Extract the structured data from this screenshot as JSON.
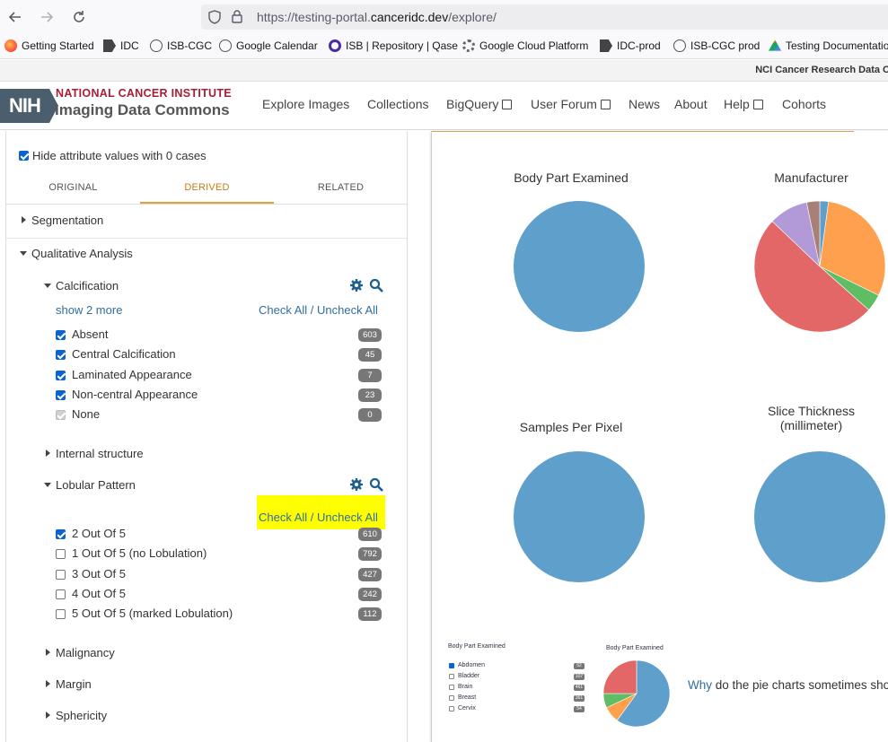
{
  "browser": {
    "url_prefix": "https://testing-portal.",
    "url_domain": "canceridc.dev",
    "url_path": "/explore/",
    "bookmarks": [
      "Getting Started",
      "IDC",
      "ISB-CGC",
      "Google Calendar",
      "ISB | Repository | Qase",
      "Google Cloud Platform",
      "IDC-prod",
      "ISB-CGC prod",
      "Testing Documentation"
    ]
  },
  "nci_strip": "NCI Cancer Research Data C",
  "header": {
    "logo": "NIH",
    "org_line1": "NATIONAL CANCER INSTITUTE",
    "org_line2": "Imaging Data Commons",
    "nav": [
      "Explore Images",
      "Collections",
      "BigQuery",
      "User Forum",
      "News",
      "About",
      "Help",
      "Cohorts"
    ]
  },
  "filters": {
    "hide_zero_label": "Hide attribute values with 0 cases",
    "tabs": [
      "ORIGINAL",
      "DERIVED",
      "RELATED"
    ],
    "active_tab": "DERIVED",
    "segmentation": "Segmentation",
    "qualitative": "Qualitative Analysis",
    "calcification": {
      "title": "Calcification",
      "show_more": "show 2 more",
      "check_all": "Check All / Uncheck All",
      "items": [
        {
          "label": "Absent",
          "count": "603",
          "state": "checked"
        },
        {
          "label": "Central Calcification",
          "count": "45",
          "state": "checked"
        },
        {
          "label": "Laminated Appearance",
          "count": "7",
          "state": "checked"
        },
        {
          "label": "Non-central Appearance",
          "count": "23",
          "state": "checked"
        },
        {
          "label": "None",
          "count": "0",
          "state": "disabled"
        }
      ]
    },
    "internal_structure": "Internal structure",
    "lobular": {
      "title": "Lobular Pattern",
      "check_all": "Check All / Uncheck All",
      "items": [
        {
          "label": "2 Out Of 5",
          "count": "610",
          "state": "checked"
        },
        {
          "label": "1 Out Of 5 (no Lobulation)",
          "count": "792",
          "state": "unchecked"
        },
        {
          "label": "3 Out Of 5",
          "count": "427",
          "state": "unchecked"
        },
        {
          "label": "4 Out Of 5",
          "count": "242",
          "state": "unchecked"
        },
        {
          "label": "5 Out Of 5 (marked Lobulation)",
          "count": "112",
          "state": "unchecked"
        }
      ]
    },
    "malignancy": "Malignancy",
    "margin": "Margin",
    "sphericity": "Sphericity"
  },
  "charts": {
    "titles": [
      "Body Part Examined",
      "Manufacturer",
      "Samples Per Pixel",
      "Slice Thickness",
      "(millimeter)"
    ],
    "colors": [
      "#5f9fcb",
      "#e46767",
      "#ffa04f",
      "#5fbd63",
      "#b19ad7",
      "#a98077"
    ]
  },
  "chart_data": [
    {
      "type": "pie",
      "title": "Body Part Examined",
      "values": [
        1
      ],
      "colors": [
        "#5f9fcb"
      ]
    },
    {
      "type": "pie",
      "title": "Manufacturer",
      "values": [
        0.02,
        0.28,
        0.04,
        0.47,
        0.09,
        0.03
      ],
      "colors": [
        "#5f9fcb",
        "#ffa04f",
        "#5fbd63",
        "#e46767",
        "#b19ad7",
        "#a98077"
      ]
    },
    {
      "type": "pie",
      "title": "Samples Per Pixel",
      "values": [
        1
      ],
      "colors": [
        "#5f9fcb"
      ]
    },
    {
      "type": "pie",
      "title": "Slice Thickness (millimeter)",
      "values": [
        1
      ],
      "colors": [
        "#5f9fcb"
      ]
    }
  ],
  "help": {
    "mini_title": "Body Part Examined",
    "mini_items": [
      {
        "label": "Abdomen",
        "count": "52",
        "checked": true
      },
      {
        "label": "Bladder",
        "count": "107",
        "checked": false
      },
      {
        "label": "Brain",
        "count": "461",
        "checked": false
      },
      {
        "label": "Breast",
        "count": "361",
        "checked": false
      },
      {
        "label": "Cervix",
        "count": "54",
        "checked": false
      }
    ],
    "mini_pie_values": [
      0.6,
      0.08,
      0.07,
      0.25
    ],
    "mini_pie_colors": [
      "#5f9fcb",
      "#ffa04f",
      "#5fbd63",
      "#e46767"
    ],
    "why_link": "Why",
    "why_rest": " do the pie charts sometimes show"
  }
}
